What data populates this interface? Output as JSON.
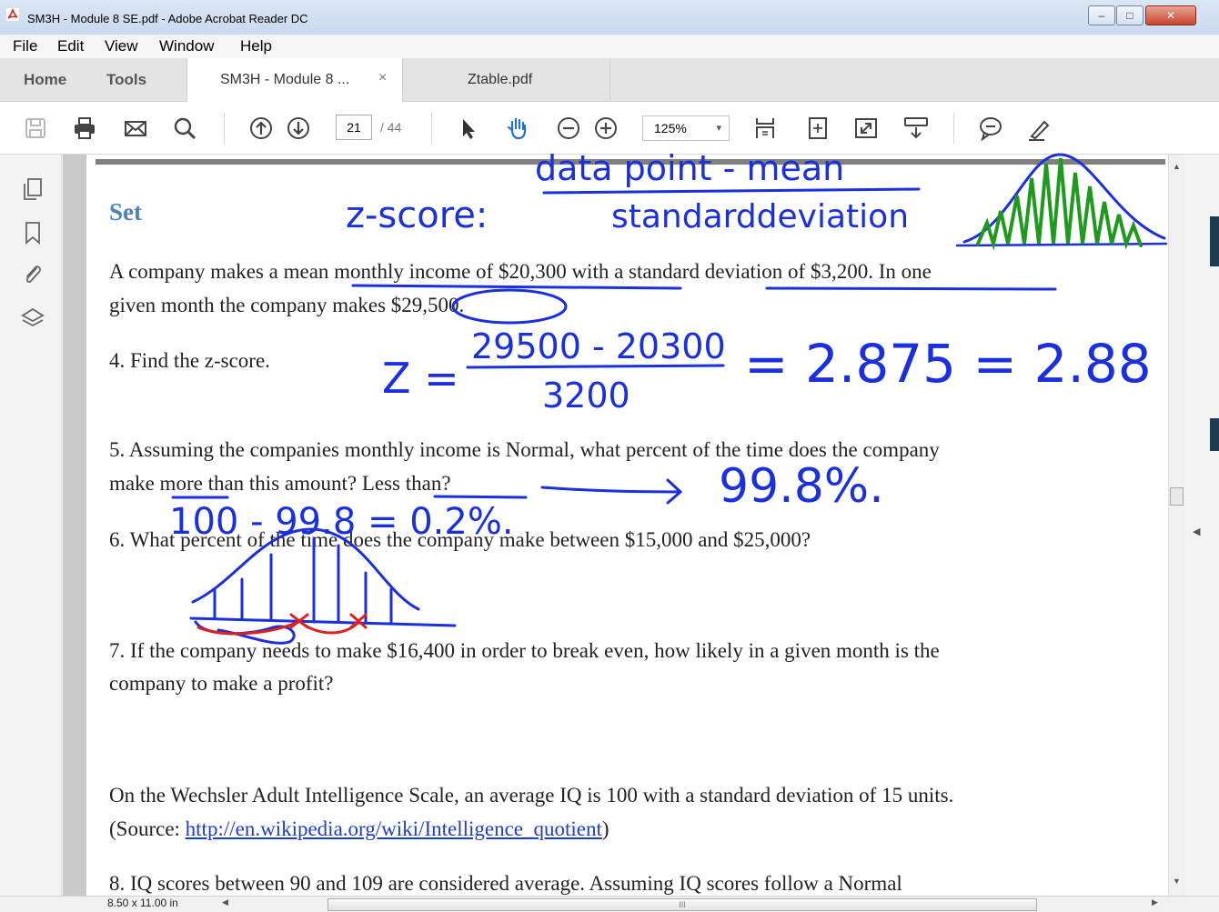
{
  "window": {
    "title": "SM3H - Module 8 SE.pdf - Adobe Acrobat Reader DC",
    "controls": {
      "minimize": "–",
      "maximize": "□",
      "close": "✕"
    }
  },
  "menu": [
    "File",
    "Edit",
    "View",
    "Window",
    "Help"
  ],
  "tabs": {
    "home": "Home",
    "tools": "Tools",
    "documents": [
      {
        "label": "SM3H - Module 8 ...",
        "close": "×",
        "active": true
      },
      {
        "label": "Ztable.pdf",
        "active": false
      }
    ]
  },
  "toolbar": {
    "page_current": "21",
    "page_total": "/ 44",
    "zoom": "125%",
    "zoom_caret": "▾",
    "icons": [
      "save-icon",
      "print-icon",
      "email-icon",
      "search-icon",
      "prev-page-icon",
      "next-page-icon",
      "select-cursor-icon",
      "hand-tool-icon",
      "zoom-out-icon",
      "zoom-in-icon",
      "scroll-mode-icon",
      "fit-page-icon",
      "full-screen-icon",
      "read-mode-icon",
      "comment-icon",
      "sign-icon"
    ]
  },
  "left_nav": {
    "icons": [
      "pages-thumbnail-icon",
      "bookmark-icon",
      "attachment-icon",
      "layers-icon"
    ],
    "collapse": "◀"
  },
  "right_nav": {
    "collapse": "◀"
  },
  "document": {
    "heading": "Set",
    "para1_line1": "A company makes a mean monthly income of $20,300 with a standard deviation of $3,200.  In one",
    "para1_line2": "given month the company makes $29,500.",
    "q4": "4.  Find the z-score.",
    "q5_line1": "5.  Assuming the companies monthly income is Normal, what percent of the time does the company",
    "q5_line2": "make more than this amount?  Less than?",
    "q6": "6.  What percent of the time does the company make between $15,000 and $25,000?",
    "q7_line1": "7.  If the company needs to make $16,400 in order to break even, how likely in a given month is the",
    "q7_line2": "company to make a profit?",
    "iq_line1": "On the Wechsler Adult Intelligence Scale, an average IQ is 100 with a standard deviation of 15 units.",
    "iq_source_prefix": "(Source: ",
    "iq_source_link": "http://en.wikipedia.org/wiki/Intelligence_quotient",
    "iq_source_suffix": ")",
    "q8_partial": "8.  IQ scores between 90 and 109 are considered average.  Assuming IQ scores follow a Normal"
  },
  "annotations": {
    "colors": {
      "blue_ink": "#1a2fe0",
      "red_ink": "#e0201a",
      "green_ink": "#1f9a1f"
    },
    "zscore_label": "z-score:",
    "formula_numerator": "data point - mean",
    "formula_denominator": "standarddeviation",
    "z_eq": "Z =",
    "z_numerator": "29500 - 20300",
    "z_denominator": "3200",
    "z_result": "= 2.875  = 2.88",
    "percent_answer": "99.8%.",
    "complement": "100 - 99.8 = 0.2%."
  },
  "status": {
    "page_size": "8.50 x 11.00 in",
    "hscroll_grip": "III"
  }
}
